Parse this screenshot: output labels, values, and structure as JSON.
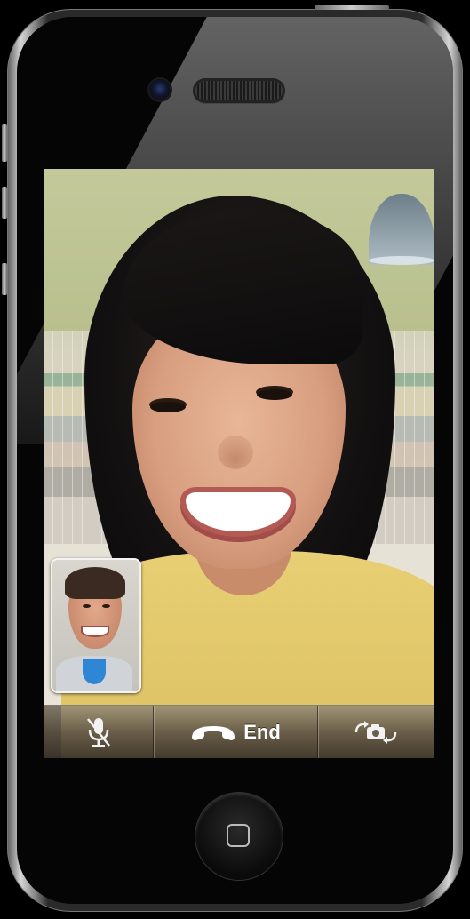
{
  "device": {
    "name": "iPhone 4",
    "home_button_icon": "home-square-icon"
  },
  "facetime": {
    "remote_video": "remote-participant-video",
    "self_preview": "self-camera-preview",
    "controls": {
      "mute_icon": "mic-muted-icon",
      "end_label": "End",
      "end_icon": "phone-handset-icon",
      "flip_icon": "camera-flip-icon"
    }
  },
  "colors": {
    "toolbar": "#5f5546",
    "end_text": "#ffffff"
  }
}
